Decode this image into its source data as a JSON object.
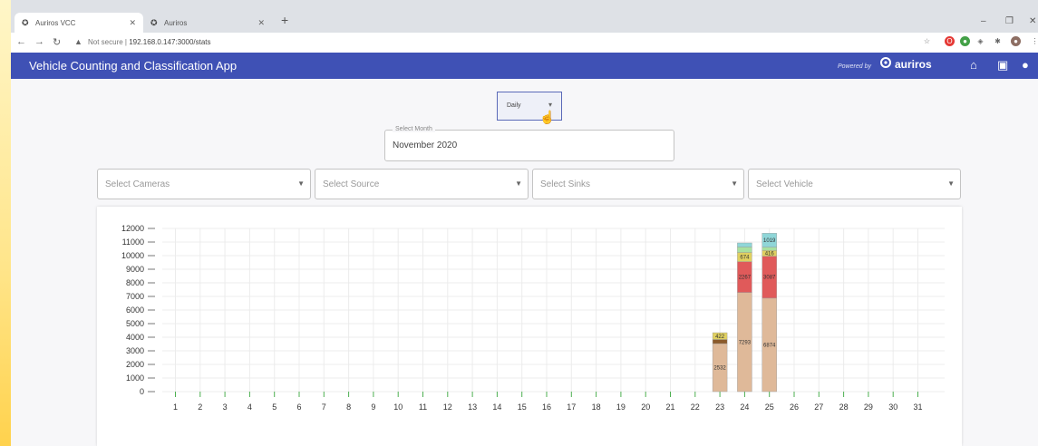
{
  "browser": {
    "tabs": [
      {
        "title": "Auriros VCC",
        "active": true
      },
      {
        "title": "Auriros",
        "active": false
      }
    ],
    "url_prefix": "Not secure",
    "url": "192.168.0.147:3000/stats"
  },
  "app": {
    "title": "Vehicle Counting and Classification App",
    "powered_by": "Powered by",
    "brand": "auriros",
    "nav_icons": [
      "home-icon",
      "dashboard-icon",
      "account-icon"
    ],
    "color": "#3f51b5"
  },
  "controls": {
    "toggle_label": "Daily",
    "month_label": "Select Month",
    "month_value": "November 2020",
    "cameras_placeholder": "Select Cameras",
    "source_placeholder": "Select Source",
    "sinks_placeholder": "Select Sinks",
    "vehicle_placeholder": "Select Vehicle"
  },
  "chart_data": {
    "type": "bar",
    "stacked": true,
    "x": [
      1,
      2,
      3,
      4,
      5,
      6,
      7,
      8,
      9,
      10,
      11,
      12,
      13,
      14,
      15,
      16,
      17,
      18,
      19,
      20,
      21,
      22,
      23,
      24,
      25,
      26,
      27,
      28,
      29,
      30,
      31
    ],
    "ylim": [
      0,
      12000
    ],
    "yticks": [
      0,
      1000,
      2000,
      3000,
      4000,
      5000,
      6000,
      7000,
      8000,
      9000,
      10000,
      11000,
      12000
    ],
    "grid": true,
    "series": [
      {
        "color": "#dfb999",
        "values": [
          0,
          0,
          0,
          0,
          0,
          0,
          0,
          0,
          0,
          0,
          0,
          0,
          0,
          0,
          0,
          0,
          0,
          0,
          0,
          0,
          0,
          0,
          3532,
          7293,
          6874,
          0,
          0,
          0,
          0,
          0,
          0
        ],
        "labels": {
          "23": "2532",
          "24": "7293",
          "25": "6874"
        }
      },
      {
        "color": "#8b5a2b",
        "values": [
          0,
          0,
          0,
          0,
          0,
          0,
          0,
          0,
          0,
          0,
          0,
          0,
          0,
          0,
          0,
          0,
          0,
          0,
          0,
          0,
          0,
          0,
          300,
          0,
          0,
          0,
          0,
          0,
          0,
          0,
          0
        ],
        "labels": {}
      },
      {
        "color": "#e05a5a",
        "values": [
          0,
          0,
          0,
          0,
          0,
          0,
          0,
          0,
          0,
          0,
          0,
          0,
          0,
          0,
          0,
          0,
          0,
          0,
          0,
          0,
          0,
          0,
          0,
          2267,
          3087,
          0,
          0,
          0,
          0,
          0,
          0
        ],
        "labels": {
          "24": "2267",
          "25": "3087"
        }
      },
      {
        "color": "#e0d060",
        "values": [
          0,
          0,
          0,
          0,
          0,
          0,
          0,
          0,
          0,
          0,
          0,
          0,
          0,
          0,
          0,
          0,
          0,
          0,
          0,
          0,
          0,
          0,
          500,
          674,
          416,
          0,
          0,
          0,
          0,
          0,
          0
        ],
        "labels": {
          "23": "422",
          "24": "674",
          "25": "416"
        }
      },
      {
        "color": "#a8e0a0",
        "values": [
          0,
          0,
          0,
          0,
          0,
          0,
          0,
          0,
          0,
          0,
          0,
          0,
          0,
          0,
          0,
          0,
          0,
          0,
          0,
          0,
          0,
          0,
          0,
          400,
          250,
          0,
          0,
          0,
          0,
          0,
          0
        ],
        "labels": {}
      },
      {
        "color": "#8fd6d8",
        "values": [
          0,
          0,
          0,
          0,
          0,
          0,
          0,
          0,
          0,
          0,
          0,
          0,
          0,
          0,
          0,
          0,
          0,
          0,
          0,
          0,
          0,
          0,
          0,
          300,
          1019,
          0,
          0,
          0,
          0,
          0,
          0
        ],
        "labels": {
          "25": "1019"
        }
      }
    ]
  }
}
